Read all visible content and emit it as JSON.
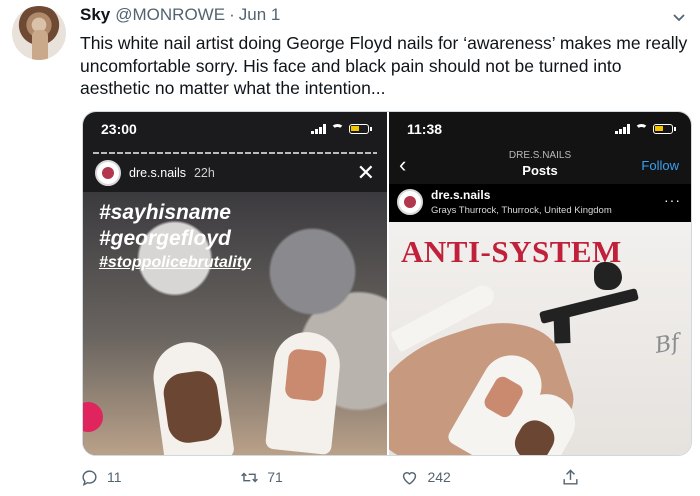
{
  "tweet": {
    "display_name": "Sky",
    "handle": "@MONROWE",
    "separator": "·",
    "date": "Jun 1",
    "text": "This white nail artist doing George Floyd nails for ‘awareness’ makes me really uncomfortable sorry. His face and black pain should not be turned into aesthetic no matter what the intention..."
  },
  "media": {
    "left": {
      "status_time": "23:00",
      "story_username": "dre.s.nails",
      "story_time": "22h",
      "close_icon": "✕",
      "hashtags": [
        "#sayhisname",
        "#georgefloyd",
        "#stoppolicebrutality"
      ]
    },
    "right": {
      "status_time": "11:38",
      "nav_subtitle": "DRE.S.NAILS",
      "nav_title": "Posts",
      "follow_label": "Follow",
      "post_username": "dre.s.nails",
      "post_location": "Grays Thurrock, Thurrock, United Kingdom",
      "more_label": "···",
      "artwork_text": "ANTI-SYSTEM",
      "signature": "Bf"
    }
  },
  "actions": {
    "replies": "11",
    "retweets": "71",
    "likes": "242"
  },
  "icons": {
    "reply": "reply-icon",
    "retweet": "retweet-icon",
    "like": "heart-icon",
    "share": "share-icon",
    "more": "chevron-down-icon"
  }
}
